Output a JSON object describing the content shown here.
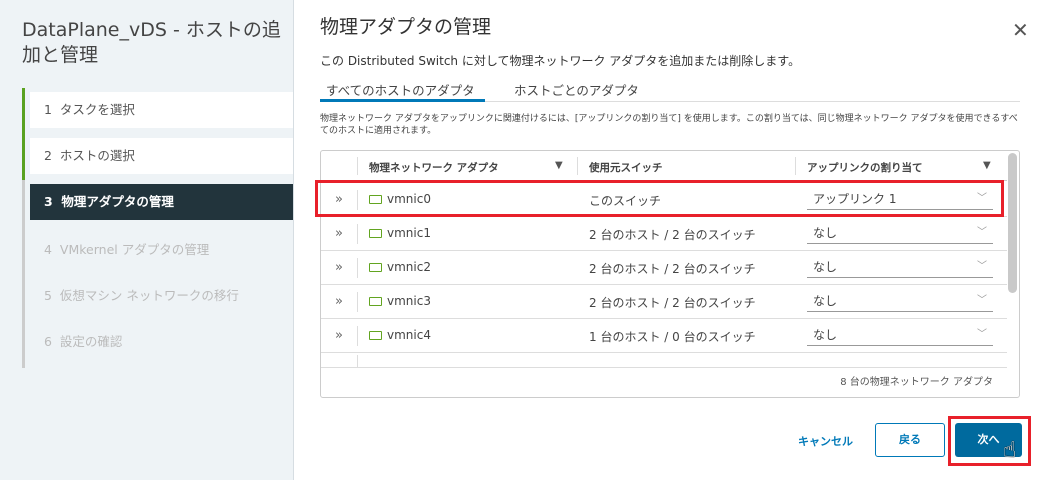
{
  "wizard": {
    "title": "DataPlane_vDS - ホストの追加と管理",
    "steps": [
      {
        "num": "1",
        "label": "タスクを選択",
        "state": "done"
      },
      {
        "num": "2",
        "label": "ホストの選択",
        "state": "done"
      },
      {
        "num": "3",
        "label": "物理アダプタの管理",
        "state": "active"
      },
      {
        "num": "4",
        "label": "VMkernel アダプタの管理",
        "state": "todo"
      },
      {
        "num": "5",
        "label": "仮想マシン ネットワークの移行",
        "state": "todo"
      },
      {
        "num": "6",
        "label": "設定の確認",
        "state": "todo"
      }
    ]
  },
  "main": {
    "title": "物理アダプタの管理",
    "close_icon": "close-icon",
    "description": "この Distributed Switch に対して物理ネットワーク アダプタを追加または削除します。",
    "tabs": [
      {
        "label": "すべてのホストのアダプタ",
        "active": true
      },
      {
        "label": "ホストごとのアダプタ",
        "active": false
      }
    ],
    "info": "物理ネットワーク アダプタをアップリンクに関連付けるには、[アップリンクの割り当て] を使用します。この割り当ては、同じ物理ネットワーク アダプタを使用できるすべてのホストに適用されます。",
    "table": {
      "columns": [
        "物理ネットワーク アダプタ",
        "使用元スイッチ",
        "アップリンクの割り当て"
      ],
      "rows": [
        {
          "adapter": "vmnic0",
          "switch": "このスイッチ",
          "uplink": "アップリンク 1"
        },
        {
          "adapter": "vmnic1",
          "switch": "2 台のホスト / 2 台のスイッチ",
          "uplink": "なし"
        },
        {
          "adapter": "vmnic2",
          "switch": "2 台のホスト / 2 台のスイッチ",
          "uplink": "なし"
        },
        {
          "adapter": "vmnic3",
          "switch": "2 台のホスト / 2 台のスイッチ",
          "uplink": "なし"
        },
        {
          "adapter": "vmnic4",
          "switch": "1 台のホスト / 0 台のスイッチ",
          "uplink": "なし"
        }
      ],
      "footer": "8 台の物理ネットワーク アダプタ"
    },
    "buttons": {
      "cancel": "キャンセル",
      "back": "戻る",
      "next": "次へ"
    }
  },
  "colors": {
    "accent": "#0079b8",
    "highlight": "#e8202a",
    "progress": "#5aa220",
    "active_step": "#22343c"
  }
}
